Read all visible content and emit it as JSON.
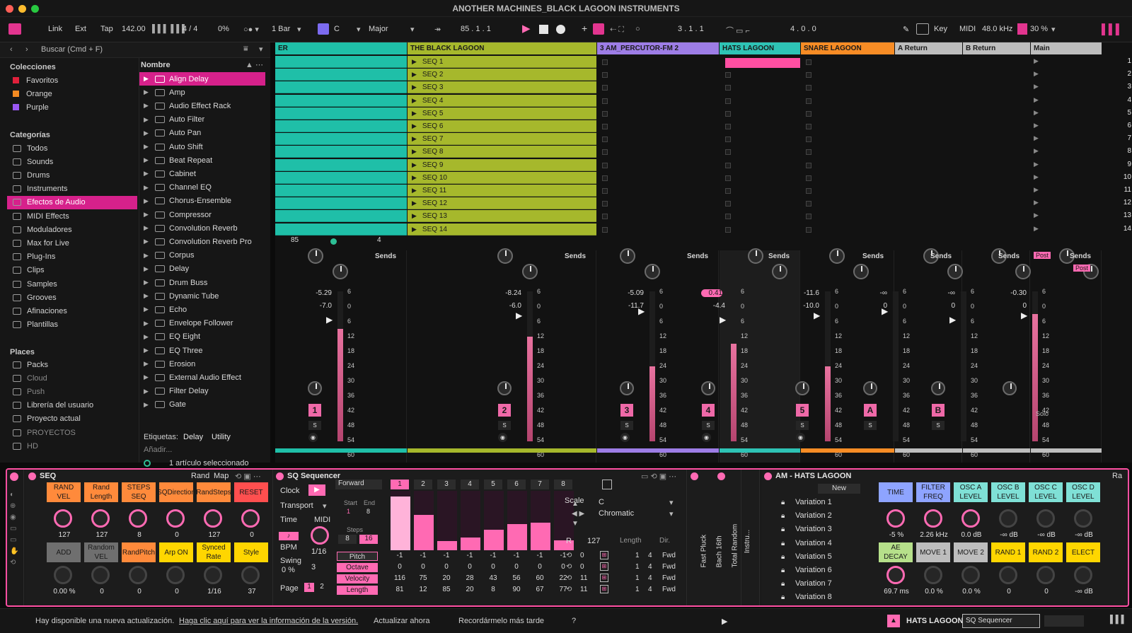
{
  "window": {
    "title": "ANOTHER MACHINES_BLACK LAGOON INSTRUMENTS"
  },
  "toolbar": {
    "link": "Link",
    "ext": "Ext",
    "tap": "Tap",
    "tempo": "142.00",
    "signature": "4 / 4",
    "cpu": "0%",
    "quantize": "1 Bar",
    "key_root": "C",
    "scale": "Major",
    "arrangement_pos": "85 .  1 .  1",
    "loop_start": "3 .  1 .  1",
    "loop_len": "4 .  0 .  0",
    "key_label": "Key",
    "midi_label": "MIDI",
    "sample_rate": "48.0 kHz",
    "cpu_meter": "30 %"
  },
  "browser": {
    "search_placeholder": "Buscar (Cmd + F)",
    "col_header": "Nombre",
    "collections_title": "Colecciones",
    "collections": [
      "Favoritos",
      "Orange",
      "Purple"
    ],
    "collection_colors": [
      "#e0203b",
      "#f58b22",
      "#9a57f2"
    ],
    "categories_title": "Categorías",
    "categories": [
      "Todos",
      "Sounds",
      "Drums",
      "Instruments",
      "Efectos de Audio",
      "MIDI Effects",
      "Moduladores",
      "Max for Live",
      "Plug-Ins",
      "Clips",
      "Samples",
      "Grooves",
      "Afinaciones",
      "Plantillas"
    ],
    "selected_category": "Efectos de Audio",
    "places_title": "Places",
    "places": [
      "Packs",
      "Cloud",
      "Push",
      "Librería del usuario",
      "Proyecto actual",
      "PROYECTOS",
      "HD"
    ],
    "items": [
      "Align Delay",
      "Amp",
      "Audio Effect Rack",
      "Auto Filter",
      "Auto Pan",
      "Auto Shift",
      "Beat Repeat",
      "Cabinet",
      "Channel EQ",
      "Chorus-Ensemble",
      "Compressor",
      "Convolution Reverb",
      "Convolution Reverb Pro",
      "Corpus",
      "Delay",
      "Drum Buss",
      "Dynamic Tube",
      "Echo",
      "Envelope Follower",
      "EQ Eight",
      "EQ Three",
      "Erosion",
      "External Audio Effect",
      "Filter Delay",
      "Gate"
    ],
    "tags_label": "Etiquetas:",
    "tags": [
      "Delay",
      "Utility"
    ],
    "add_label": "Añadir...",
    "selection_info": "1 artículo seleccionado"
  },
  "session": {
    "tracks": [
      {
        "name": "ER",
        "color": "#1fbfa8"
      },
      {
        "name": "THE BLACK LAGOON",
        "color": "#a6b82c"
      },
      {
        "name": "3 AM_PERCUTOR-FM 2",
        "color": "#9d7de6"
      },
      {
        "name": "HATS LAGOON",
        "color": "#2ec3b5"
      },
      {
        "name": "SNARE LAGOON",
        "color": "#f78c25"
      },
      {
        "name": "A Return",
        "color": "#bdbdbd"
      },
      {
        "name": "B Return",
        "color": "#bdbdbd"
      },
      {
        "name": "Main",
        "color": "#bdbdbd"
      }
    ],
    "clips": [
      "SEQ 1",
      "SEQ 2",
      "SEQ 3",
      "SEQ 4",
      "SEQ 5",
      "SEQ 6",
      "SEQ 7",
      "SEQ 8",
      "SEQ 9",
      "SEQ 10",
      "SEQ 11",
      "SEQ 12",
      "SEQ 13",
      "SEQ 14"
    ],
    "scenes": [
      "1",
      "2",
      "3",
      "4",
      "5",
      "6",
      "7",
      "8",
      "9",
      "10",
      "11",
      "12",
      "13",
      "14"
    ],
    "scroll_a": "85",
    "scroll_b": "4"
  },
  "mixer": {
    "sends_label": "Sends",
    "post_label": "Post",
    "solo_label": "Solo",
    "scale": [
      "6",
      "0",
      "6",
      "12",
      "18",
      "24",
      "30",
      "36",
      "42",
      "48",
      "54",
      "60"
    ],
    "channels": [
      {
        "num": "1",
        "peak": "-5.29",
        "vol": "-7.0",
        "meter": 0.75
      },
      {
        "num": "2",
        "peak": "-8.24",
        "vol": "-6.0",
        "meter": 0.7
      },
      {
        "num": "3",
        "peak": "-5.09",
        "vol": "-11.7",
        "meter": 0.5
      },
      {
        "num": "4",
        "peak": "0.41",
        "vol": "-4.4",
        "meter": 0.65
      },
      {
        "num": "5",
        "peak": "-11.6",
        "vol": "-10.0",
        "meter": 0.5
      },
      {
        "num": "A",
        "peak": "-∞",
        "vol": "0",
        "meter": 0
      },
      {
        "num": "B",
        "peak": "-∞",
        "vol": "0",
        "meter": 0
      },
      {
        "num": "",
        "peak": "-0.30",
        "vol": "0",
        "meter": 0.85
      }
    ]
  },
  "devices": {
    "seq": {
      "title": "SEQ",
      "rand": "Rand",
      "map": "Map",
      "top_buttons": [
        "RAND VEL",
        "Rand Length",
        "STEPS SEQ",
        "SQDirection",
        "RandSteps",
        "RESET"
      ],
      "top_values": [
        "127",
        "127",
        "8",
        "0",
        "127",
        "0"
      ],
      "bottom_buttons": [
        "ADD",
        "Random VEL",
        "RandPitch",
        "Arp ON",
        "Synced Rate",
        "Style"
      ],
      "bottom_values": [
        "0.00 %",
        "0",
        "0",
        "0",
        "1/16",
        "37"
      ]
    },
    "sq": {
      "title": "SQ Sequencer",
      "clock": "Clock",
      "transport": "Transport",
      "time": "Time",
      "midi": "MIDI",
      "bpm": "BPM",
      "rate": "1/16",
      "swing": "Swing",
      "swing_val": "0 %",
      "swing_n": "3",
      "page": "Page",
      "page1": "1",
      "page2": "2",
      "dir": "Forward",
      "start": "Start",
      "end": "End",
      "start_v": "1",
      "end_v": "8",
      "steps": "Steps",
      "steps_a": "8",
      "steps_b": "16",
      "step_numbers": [
        "1",
        "2",
        "3",
        "4",
        "5",
        "6",
        "7",
        "8"
      ],
      "pitch_label": "Pitch",
      "octave_label": "Octave",
      "velocity_label": "Velocity",
      "length_label": "Length",
      "pitch": [
        "-1",
        "-1",
        "-1",
        "-1",
        "-1",
        "-1",
        "-1",
        "-1"
      ],
      "octave": [
        "0",
        "0",
        "0",
        "0",
        "0",
        "0",
        "0",
        "0"
      ],
      "velocity": [
        "116",
        "75",
        "20",
        "28",
        "43",
        "56",
        "60",
        "22"
      ],
      "length": [
        "81",
        "12",
        "85",
        "20",
        "8",
        "90",
        "67",
        "77"
      ],
      "velocity_bars": [
        0.91,
        0.59,
        0.16,
        0.22,
        0.34,
        0.44,
        0.47,
        0.17
      ],
      "scale_label": "Scale",
      "root": "C",
      "chromatic": "Chromatic",
      "r_label": "R",
      "r_val": "127",
      "length_col": "Length",
      "dir_col": "Dir.",
      "side_rows": [
        {
          "v": "0",
          "a": "1",
          "b": "4",
          "d": "Fwd"
        },
        {
          "v": "0",
          "a": "1",
          "b": "4",
          "d": "Fwd"
        },
        {
          "v": "11",
          "a": "1",
          "b": "4",
          "d": "Fwd"
        },
        {
          "v": "11",
          "a": "1",
          "b": "4",
          "d": "Fwd"
        }
      ]
    },
    "racks": [
      "Fast Pluck",
      "Bach 16th",
      "Total Random"
    ],
    "instr": "Instru...",
    "hats": {
      "title": "AM - HATS LAGOON",
      "new": "New",
      "variations": [
        "Variation 1",
        "Variation 2",
        "Variation 3",
        "Variation 4",
        "Variation 5",
        "Variation 6",
        "Variation 7",
        "Variation 8"
      ],
      "macros_top": [
        "TIME",
        "FILTER FREQ",
        "OSC A LEVEL",
        "OSC B LEVEL",
        "OSC C LEVEL",
        "OSC D LEVEL"
      ],
      "macros_top_vals": [
        "-5 %",
        "2.26 kHz",
        "0.0 dB",
        "-∞ dB",
        "-∞ dB",
        "-∞ dB"
      ],
      "macros_bottom": [
        "AE DECAY",
        "MOVE 1",
        "MOVE 2",
        "RAND 1",
        "RAND 2",
        "ELECT"
      ],
      "macros_bottom_vals": [
        "69.7 ms",
        "0.0 %",
        "0.0 %",
        "0",
        "0",
        "-∞ dB"
      ],
      "ra": "Ra"
    }
  },
  "status": {
    "message": "Hay disponible una nueva actualización.",
    "link": "Haga clic aquí para ver la información de la versión.",
    "update_now": "Actualizar ahora",
    "remind": "Recordármelo más tarde",
    "help": "?",
    "track": "HATS LAGOON",
    "device": "SQ Sequencer"
  },
  "colors": {
    "accent": "#d6218b",
    "pink": "#ff6ab3"
  }
}
